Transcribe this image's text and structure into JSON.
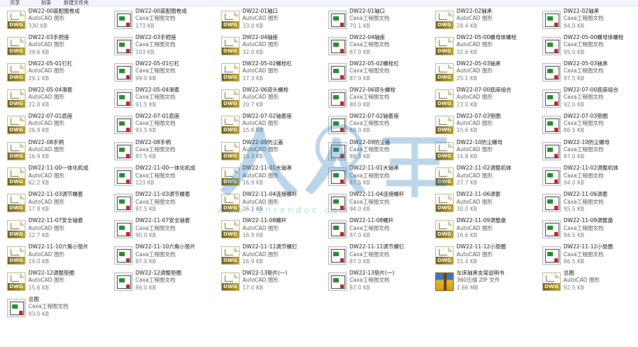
{
  "toolbar": {
    "items": [
      "共享",
      "刻录",
      "新建文件夹"
    ]
  },
  "watermark": {
    "url": "w w w . r e n r e n d o c . c o m"
  },
  "files": [
    {
      "name": "DW22-00装配图卷成",
      "type": "AutoCAD 图形",
      "size": "330 KB",
      "icon": "dwg"
    },
    {
      "name": "DW22-00装配图卷成",
      "type": "Caxa工程图文档",
      "size": "173 KB",
      "icon": "exb"
    },
    {
      "name": "DW22-01轴口",
      "type": "AutoCAD 图形",
      "size": "33.0 KB",
      "icon": "dwg"
    },
    {
      "name": "DW22-01轴口",
      "type": "Caxa工程图文档",
      "size": "70.1 KB",
      "icon": "exb"
    },
    {
      "name": "DW22-02轴承",
      "type": "AutoCAD 图形",
      "size": "28.4 KB",
      "icon": "dwg"
    },
    {
      "name": "DW22-02轴承",
      "type": "Caxa工程图文档",
      "size": "94.0 KB",
      "icon": "exb"
    },
    {
      "name": "DW22-03手把座",
      "type": "AutoCAD 图形",
      "size": "39.6 KB",
      "icon": "dwg"
    },
    {
      "name": "DW22-03手把座",
      "type": "Caxa工程图文档",
      "size": "103 KB",
      "icon": "exb"
    },
    {
      "name": "DW22-04轴座",
      "type": "AutoCAD 图形",
      "size": "32.0 KB",
      "icon": "dwg"
    },
    {
      "name": "DW22-04轴座",
      "type": "Caxa工程图文档",
      "size": "87.0 KB",
      "icon": "exb"
    },
    {
      "name": "DW22-05-00螺母体螺栓",
      "type": "AutoCAD 图形",
      "size": "32.6 KB",
      "icon": "dwg"
    },
    {
      "name": "DW22-05-00螺母体螺栓",
      "type": "Caxa工程图文档",
      "size": "95.0 KB",
      "icon": "exb"
    },
    {
      "name": "DW22-05-01钉杠",
      "type": "AutoCAD 图形",
      "size": "29.1 KB",
      "icon": "dwg"
    },
    {
      "name": "DW22-05-01钉杠",
      "type": "Caxa工程图文档",
      "size": "99.0 KB",
      "icon": "exb"
    },
    {
      "name": "DW22-05-02螺栓杠",
      "type": "AutoCAD 图形",
      "size": "17.3 KB",
      "icon": "dwg"
    },
    {
      "name": "DW22-05-02螺栓杠",
      "type": "Caxa工程图文档",
      "size": "87.0 KB",
      "icon": "exb"
    },
    {
      "name": "DW22-05-03轴承",
      "type": "AutoCAD 图形",
      "size": "25.1 KB",
      "icon": "dwg"
    },
    {
      "name": "DW22-05-03轴承",
      "type": "Caxa工程图文档",
      "size": "97.5 KB",
      "icon": "exb"
    },
    {
      "name": "DW22-05-04滑套",
      "type": "AutoCAD 图形",
      "size": "22.8 KB",
      "icon": "dwg"
    },
    {
      "name": "DW22-05-04滑套",
      "type": "Caxa工程图文档",
      "size": "91.5 KB",
      "icon": "exb"
    },
    {
      "name": "DW22-06双头螺栓",
      "type": "AutoCAD 图形",
      "size": "20.7 KB",
      "icon": "dwg"
    },
    {
      "name": "DW22-06双头螺栓",
      "type": "Caxa工程图文档",
      "size": "80.0 KB",
      "icon": "exb"
    },
    {
      "name": "DW22-07-00底座组合",
      "type": "AutoCAD 图形",
      "size": "23.0 KB",
      "icon": "dwg"
    },
    {
      "name": "DW22-07-00底座组合",
      "type": "Caxa工程图文档",
      "size": "92.0 KB",
      "icon": "exb"
    },
    {
      "name": "DW22-07-01底座",
      "type": "AutoCAD 图形",
      "size": "26.9 KB",
      "icon": "dwg"
    },
    {
      "name": "DW22-07-01底座",
      "type": "Caxa工程图文档",
      "size": "93.5 KB",
      "icon": "exb"
    },
    {
      "name": "DW22-07-02轴套座",
      "type": "AutoCAD 图形",
      "size": "15.8 KB",
      "icon": "dwg"
    },
    {
      "name": "DW22-07-02轴套座",
      "type": "Caxa工程图文档",
      "size": "88.0 KB",
      "icon": "exb"
    },
    {
      "name": "DW22-07-03垫圈",
      "type": "AutoCAD 图形",
      "size": "15.6 KB",
      "icon": "dwg"
    },
    {
      "name": "DW22-07-03垫圈",
      "type": "Caxa工程图文档",
      "size": "86.5 KB",
      "icon": "exb"
    },
    {
      "name": "DW22-08手柄",
      "type": "AutoCAD 图形",
      "size": "16.9 KB",
      "icon": "dwg"
    },
    {
      "name": "DW22-08手柄",
      "type": "Caxa工程图文档",
      "size": "87.5 KB",
      "icon": "exb"
    },
    {
      "name": "DW22-09防尘盖",
      "type": "AutoCAD 图形",
      "size": "19.3 KB",
      "icon": "dwg"
    },
    {
      "name": "DW22-09防尘盖",
      "type": "Caxa工程图文档",
      "size": "88.5 KB",
      "icon": "exb"
    },
    {
      "name": "DW22-10防尘螺母",
      "type": "AutoCAD 图形",
      "size": "14.8 KB",
      "icon": "dwg"
    },
    {
      "name": "DW22-10防尘螺母",
      "type": "Caxa工程图文档",
      "size": "87.0 KB",
      "icon": "exb"
    },
    {
      "name": "DW22-11-00一体化机成",
      "type": "AutoCAD 图形",
      "size": "62.2 KB",
      "icon": "dwg"
    },
    {
      "name": "DW22-11-00一体化机成",
      "type": "Caxa工程图文档",
      "size": "123 KB",
      "icon": "exb"
    },
    {
      "name": "DW22-11-01大轴承",
      "type": "AutoCAD 图形",
      "size": "16.9 KB",
      "icon": "dwg"
    },
    {
      "name": "DW22-11-01大轴承",
      "type": "Caxa工程图文档",
      "size": "87.5 KB",
      "icon": "exb"
    },
    {
      "name": "DW22-11-02调整机体",
      "type": "AutoCAD 图形",
      "size": "27.7 KB",
      "icon": "dwg"
    },
    {
      "name": "DW22-11-02调整机体",
      "type": "Caxa工程图文档",
      "size": "94.0 KB",
      "icon": "exb"
    },
    {
      "name": "DW22-11-03调节螺套",
      "type": "AutoCAD 图形",
      "size": "17.9 KB",
      "icon": "dwg"
    },
    {
      "name": "DW22-11-03调节螺套",
      "type": "Caxa工程图文档",
      "size": "87.5 KB",
      "icon": "exb"
    },
    {
      "name": "DW22-11-04连接螺杆",
      "type": "AutoCAD 图形",
      "size": "26.1 KB",
      "icon": "dwg"
    },
    {
      "name": "DW22-11-04连接螺杆",
      "type": "Caxa工程图文档",
      "size": "94.0 KB",
      "icon": "exb"
    },
    {
      "name": "DW22-11-06调套",
      "type": "AutoCAD 图形",
      "size": "30.0 KB",
      "icon": "dwg"
    },
    {
      "name": "DW22-11-06调套",
      "type": "Caxa工程图文档",
      "size": "95.5 KB",
      "icon": "exb"
    },
    {
      "name": "DW22-11-07安全轴套",
      "type": "AutoCAD 图形",
      "size": "22.7 KB",
      "icon": "dwg"
    },
    {
      "name": "DW22-11-07安全轴套",
      "type": "Caxa工程图文档",
      "size": "90.0 KB",
      "icon": "exb"
    },
    {
      "name": "DW22-11-08螺杆",
      "type": "AutoCAD 图形",
      "size": "16.9 KB",
      "icon": "dwg"
    },
    {
      "name": "DW22-11-08螺杆",
      "type": "Caxa工程图文档",
      "size": "87.0 KB",
      "icon": "exb"
    },
    {
      "name": "DW22-11-09调整盘",
      "type": "AutoCAD 图形",
      "size": "16.6 KB",
      "icon": "dwg"
    },
    {
      "name": "DW22-11-09调整盘",
      "type": "Caxa工程图文档",
      "size": "84.5 KB",
      "icon": "exb"
    },
    {
      "name": "DW22-11-10六角小垫片",
      "type": "AutoCAD 图形",
      "size": "19.0 KB",
      "icon": "dwg"
    },
    {
      "name": "DW22-11-10六角小垫片",
      "type": "Caxa工程图文档",
      "size": "87.0 KB",
      "icon": "exb"
    },
    {
      "name": "DW22-11-11调节螺钉",
      "type": "AutoCAD 图形",
      "size": "16.9 KB",
      "icon": "dwg"
    },
    {
      "name": "DW22-11-11调节螺钉",
      "type": "Caxa工程图文档",
      "size": "87.0 KB",
      "icon": "exb"
    },
    {
      "name": "DW22-11-12小垫圈",
      "type": "AutoCAD 图形",
      "size": "15.4 KB",
      "icon": "dwg"
    },
    {
      "name": "DW22-11-12小垫圈",
      "type": "Caxa工程图文档",
      "size": "86.5 KB",
      "icon": "exb"
    },
    {
      "name": "DW22-12调整垫圈",
      "type": "AutoCAD 图形",
      "size": "15.6 KB",
      "icon": "dwg"
    },
    {
      "name": "DW22-12调整垫圈",
      "type": "Caxa工程图文档",
      "size": "86.0 KB",
      "icon": "exb"
    },
    {
      "name": "DW22-13垫片(一)",
      "type": "AutoCAD 图形",
      "size": "17.0 KB",
      "icon": "dwg"
    },
    {
      "name": "DW22-13垫片(一)",
      "type": "Caxa工程图文档",
      "size": "87.0 KB",
      "icon": "exb"
    },
    {
      "name": "车床轴承支架说明书",
      "type": "360压缩 ZIP 文件",
      "size": "1.66 MB",
      "icon": "zip"
    },
    {
      "name": "总图",
      "type": "AutoCAD 图形",
      "size": "92.5 KB",
      "icon": "dwg"
    },
    {
      "name": "总图",
      "type": "Caxa工程图文档",
      "size": "93.0 KB",
      "icon": "exb"
    }
  ]
}
